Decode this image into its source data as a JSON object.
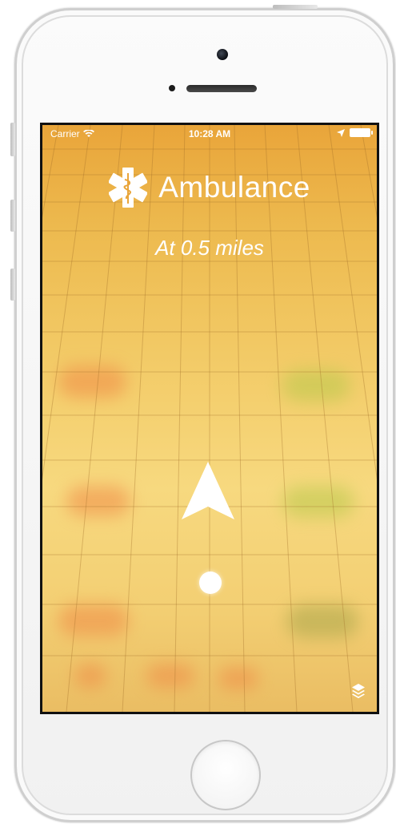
{
  "status_bar": {
    "carrier": "Carrier",
    "time": "10:28 AM"
  },
  "header": {
    "title": "Ambulance",
    "subtitle": "At 0.5 miles",
    "icon": "star-of-life-icon"
  },
  "colors": {
    "screen_top": "#e9a53a",
    "screen_bottom": "#eabd63",
    "foreground": "#ffffff"
  },
  "controls": {
    "layers_icon": "layers-icon",
    "direction_icon": "navigation-arrow-icon"
  }
}
